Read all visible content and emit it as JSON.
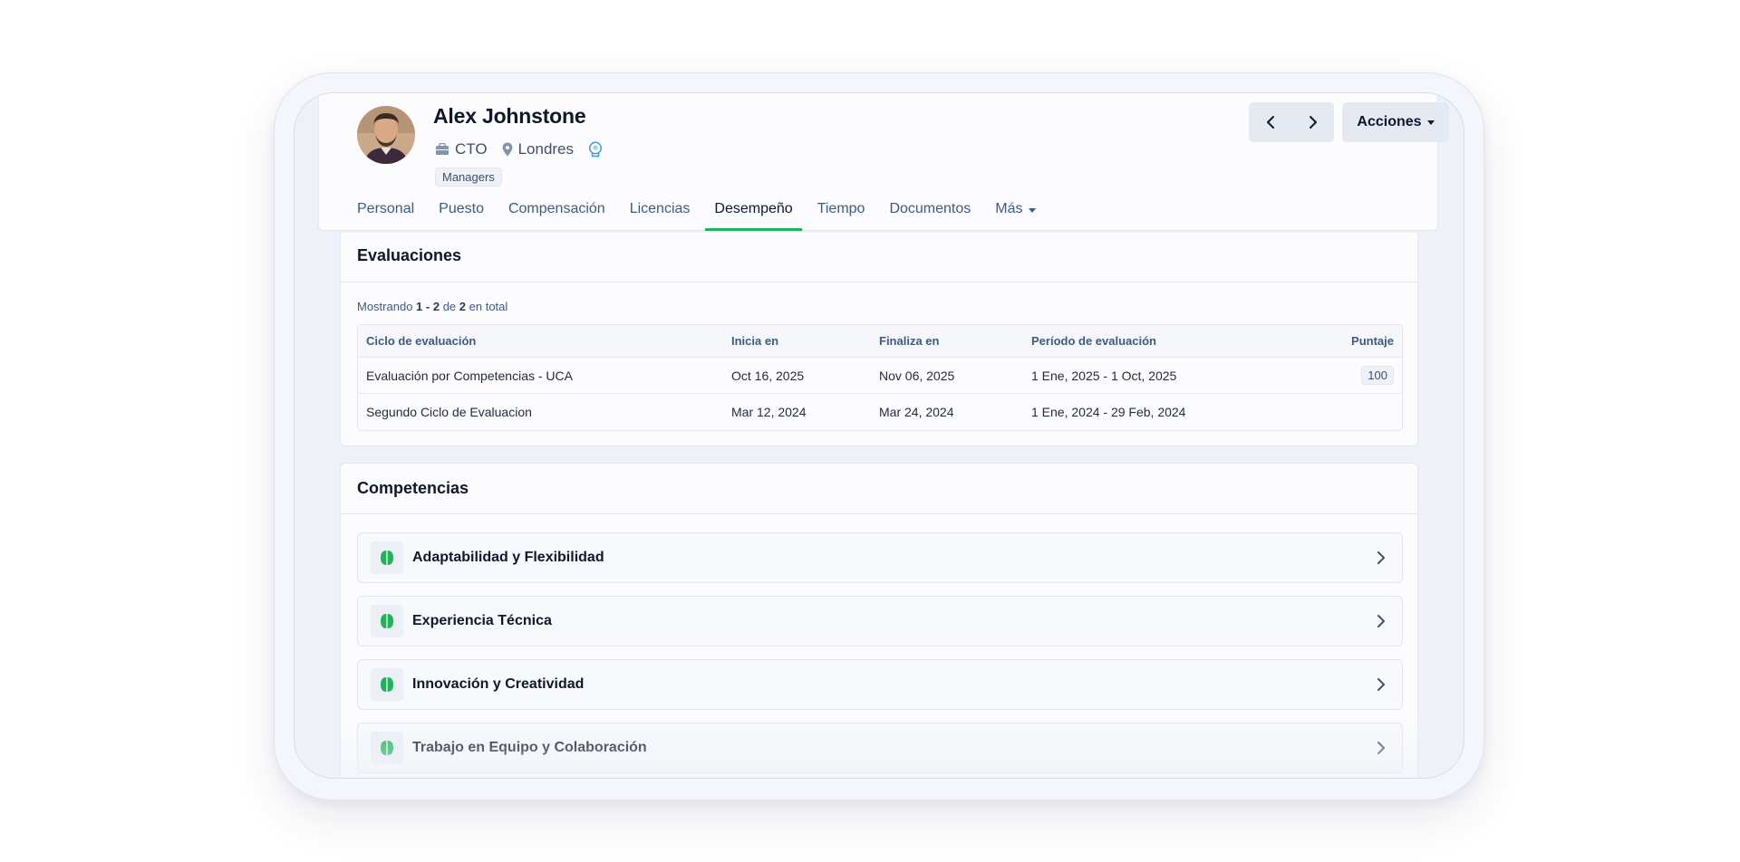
{
  "profile": {
    "name": "Alex Johnstone",
    "role": "CTO",
    "location": "Londres",
    "tag": "Managers",
    "role_icon": "briefcase-icon",
    "location_icon": "map-pin-icon",
    "extra_icon": "brain-head-icon"
  },
  "header_actions": {
    "prev_icon": "chevron-left-icon",
    "next_icon": "chevron-right-icon",
    "actions_label": "Acciones"
  },
  "tabs": [
    {
      "label": "Personal",
      "active": false
    },
    {
      "label": "Puesto",
      "active": false
    },
    {
      "label": "Compensación",
      "active": false
    },
    {
      "label": "Licencias",
      "active": false
    },
    {
      "label": "Desempeño",
      "active": true
    },
    {
      "label": "Tiempo",
      "active": false
    },
    {
      "label": "Documentos",
      "active": false
    },
    {
      "label": "Más",
      "active": false
    }
  ],
  "evaluaciones": {
    "title": "Evaluaciones",
    "showing_prefix": "Mostrando",
    "showing_range": "1 - 2",
    "showing_of": "de",
    "showing_total": "2",
    "showing_suffix": "en total",
    "columns": [
      "Ciclo de evaluación",
      "Inicia en",
      "Finaliza en",
      "Período de evaluación",
      "Puntaje"
    ],
    "rows": [
      {
        "cycle": "Evaluación por Competencias - UCA",
        "start": "Oct 16, 2025",
        "end": "Nov 06, 2025",
        "period": "1 Ene, 2025 - 1 Oct, 2025",
        "score": "100"
      },
      {
        "cycle": "Segundo Ciclo de Evaluacion",
        "start": "Mar 12, 2024",
        "end": "Mar 24, 2024",
        "period": "1 Ene, 2024 - 29 Feb, 2024",
        "score": ""
      }
    ]
  },
  "competencias": {
    "title": "Competencias",
    "items": [
      {
        "label": "Adaptabilidad y Flexibilidad",
        "icon": "brain-icon"
      },
      {
        "label": "Experiencia Técnica",
        "icon": "brain-icon"
      },
      {
        "label": "Innovación y Creatividad",
        "icon": "brain-icon"
      },
      {
        "label": "Trabajo en Equipo y Colaboración",
        "icon": "brain-icon"
      }
    ]
  },
  "colors": {
    "accent": "#1fb35a",
    "text": "#0f172a",
    "muted": "#3e5a80"
  }
}
